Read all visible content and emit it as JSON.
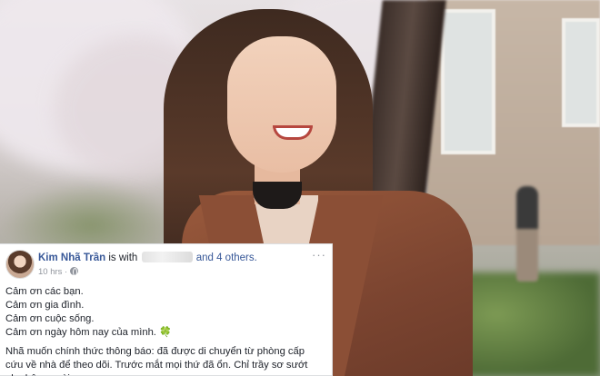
{
  "post": {
    "author": "Kim Nhã Trần",
    "with_text": "is with",
    "others_text": "and 4 others.",
    "timestamp": "10 hrs",
    "more_label": "···",
    "lines": [
      "Cảm ơn các bạn.",
      "Cảm ơn gia đình.",
      "Cảm ơn cuộc sống.",
      "Cảm ơn ngày hôm nay của mình."
    ],
    "announcement": "Nhã muốn chính thức thông báo: đã được di chuyển từ phòng cấp cứu về nhà để theo dõi. Trước mắt mọi thứ đã ổn. Chỉ trầy sơ sướt nhẹ bên ngoài.",
    "clover_glyph": "🍀"
  },
  "icons": {
    "globe": "globe-icon",
    "more": "more-icon",
    "clover": "clover-icon"
  },
  "colors": {
    "link": "#385898",
    "meta": "#90949c",
    "text": "#1d2129"
  }
}
